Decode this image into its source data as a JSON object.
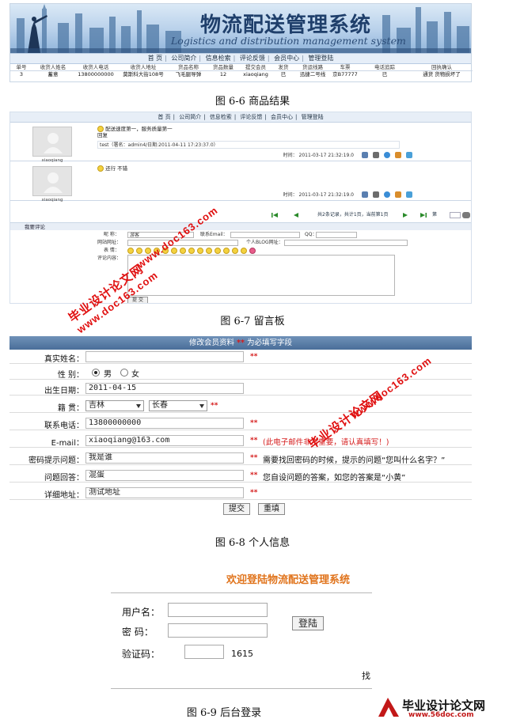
{
  "fig1": {
    "banner_title": "物流配送管理系统",
    "banner_subtitle": "Logistics and distribution management system",
    "nav": [
      "首 页",
      "公司简介",
      "信息检索",
      "评论反馈",
      "会员中心",
      "管理登陆"
    ],
    "table_headers": [
      "单号",
      "收货人姓名",
      "收货人电话",
      "收货人地址",
      "货品名称",
      "货品数量",
      "提交会员",
      "发货",
      "货运线路",
      "车票",
      "电话追踪",
      "回执确认"
    ],
    "table_row": [
      "3",
      "蓄意",
      "13800000000",
      "莫斯科大街108号",
      "飞毛腿导弹",
      "12",
      "xiaoqiang",
      "已",
      "迅捷二号线",
      "京B77777",
      "已",
      "通货 货物损坏了"
    ],
    "caption": "图 6-6  商品结果"
  },
  "fig2": {
    "nav": [
      "首 页",
      "公司简介",
      "信息检索",
      "评论反馈",
      "会员中心",
      "管理登陆"
    ],
    "messages": [
      {
        "user": "xiaoqiang",
        "text": "配送速度第一，服务质量第一",
        "reply_label": "回复",
        "reply_text": "test（署名：admin4/日期:2011-04-11 17:23:37.0）",
        "time": "时间： 2011-03-17 21:32:19.0"
      },
      {
        "user": "xiaoqiang",
        "text": "还行 不错",
        "time": "时间： 2011-03-17 21:32:19.0"
      }
    ],
    "pager_text": "共2条记录，共计1页，当前第1页",
    "pager_label": "第",
    "comment_heading": "我要评论",
    "form": {
      "nickname_label": "昵    称：",
      "nickname_value": "游客",
      "email_label": "联系Email：",
      "qq_label": "QQ：",
      "site_label": "网站网址：",
      "blog_label": "个人BLOG网址：",
      "mood_label": "表    情：",
      "content_label": "评论内容：",
      "submit_label": "提 交"
    },
    "caption": "图 6-7  留言板"
  },
  "fig3": {
    "header": "修改会员资料",
    "header_required_mark": "**",
    "header_required_text": "为必填写字段",
    "name_label": "真实姓名：",
    "gender_label": "性    别：",
    "gender_male": "男",
    "gender_female": "女",
    "birth_label": "出生日期：",
    "birth_value": "2011-04-15",
    "native_label": "籍    贯：",
    "province": "吉林",
    "city": "长春",
    "phone_label": "联系电话：",
    "phone_value": "13800000000",
    "email_label": "E-mail：",
    "email_value": "xiaoqiang@163.com",
    "email_note": "(此电子邮件非常重要，请认真填写！)",
    "question_label": "密码提示问题：",
    "question_value": "我是谁",
    "question_note": "需要找回密码的时候，提示的问题“您叫什么名字？”",
    "answer_label": "问题回答：",
    "answer_value": "混蛋",
    "answer_note": "您自设问题的答案，如您的答案是“小黄”",
    "address_label": "详细地址：",
    "address_value": "测试地址",
    "required_mark": "**",
    "submit_label": "提交",
    "reset_label": "重填",
    "caption": "图 6-8  个人信息"
  },
  "fig4": {
    "title": "欢迎登陆物流配送管理系统",
    "username_label": "用户名：",
    "password_label": "密    码：",
    "captcha_label": "验证码：",
    "captcha_value": "1615",
    "login_label": "登陆",
    "find_label": "找",
    "caption": "图 6-9  后台登录"
  },
  "watermark": {
    "cn": "毕业设计论文网",
    "url": "www.doc163.com"
  },
  "logo": {
    "cn": "毕业设计论文网",
    "url": "www.56doc.com"
  },
  "colors": {
    "accent_blue": "#4a6e99",
    "required_red": "#d51b1b",
    "login_title_orange": "#e0731b"
  }
}
